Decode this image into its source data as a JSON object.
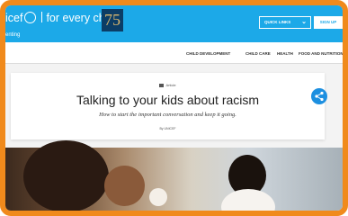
{
  "brand": {
    "logo_text_start": "icef",
    "logo_text_end": "for every child",
    "anniversary": "75",
    "section": "enting"
  },
  "header": {
    "quick_links_label": "QUICK LINKS",
    "signup_label": "SIGN UP"
  },
  "nav": {
    "items": [
      "CHILD DEVELOPMENT",
      "CHILD CARE",
      "HEALTH",
      "FOOD AND NUTRITION"
    ]
  },
  "article": {
    "kind": "Article",
    "title": "Talking to your kids about racism",
    "subtitle": "How to start the important conversation and keep it going.",
    "author": "By UNICEF"
  },
  "colors": {
    "header_bg": "#1ca9e8",
    "frame": "#f08a1c",
    "share_button": "#1c8fe0",
    "anniversary_bg": "#0b3d66"
  },
  "icons": {
    "logo": "globe-icon",
    "quick_links": "chevron-down-icon",
    "share": "share-icon",
    "article_kind": "article-icon"
  }
}
